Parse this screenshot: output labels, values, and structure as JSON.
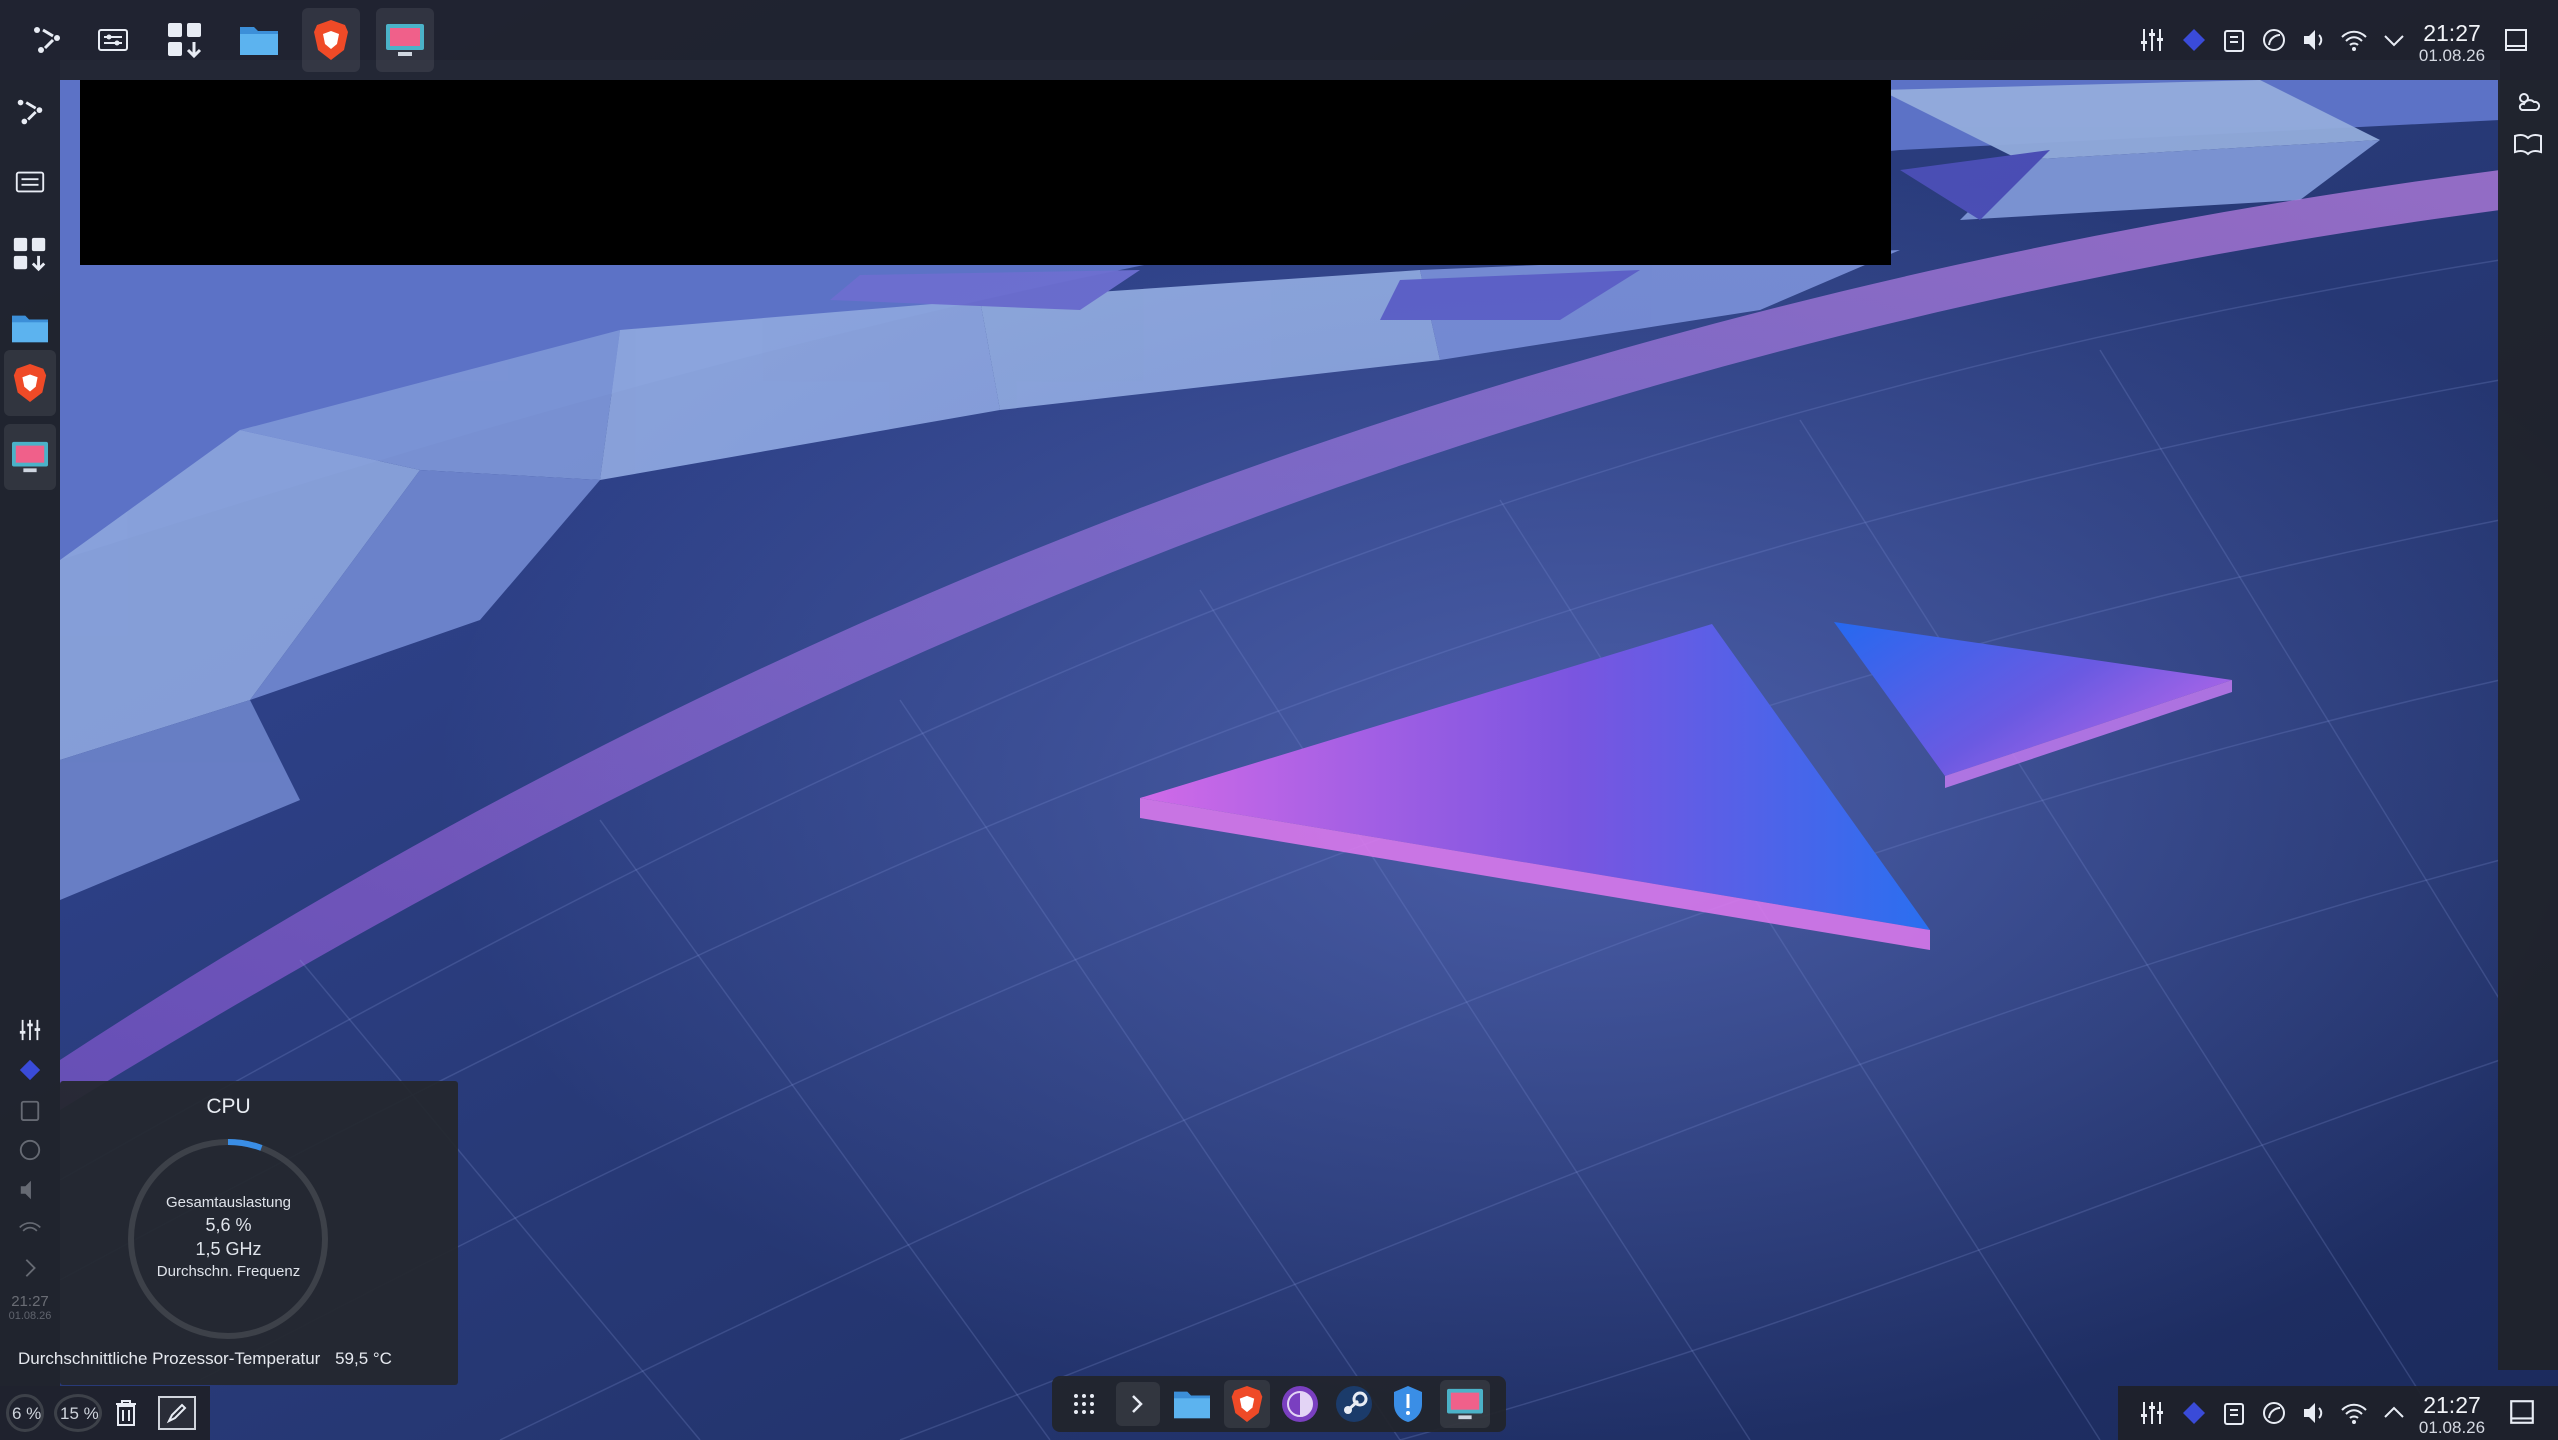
{
  "top_panel": {
    "launchers": [
      {
        "name": "kde-connect-icon"
      },
      {
        "name": "settings-icon"
      },
      {
        "name": "discover-icon"
      },
      {
        "name": "dolphin-icon"
      },
      {
        "name": "brave-icon"
      },
      {
        "name": "screen-tool-icon"
      }
    ],
    "tray": [
      "mixer-icon",
      "diamond-icon",
      "clipboard-icon",
      "vpn-icon",
      "volume-icon",
      "wifi-icon",
      "chevron-down-icon"
    ],
    "clock": {
      "time": "21:27",
      "date": "01.08.26"
    }
  },
  "bottom_panel": {
    "clock": {
      "time": "21:27",
      "date": "01.08.26"
    },
    "left_stats": {
      "cpu": "6 %",
      "mem": "15 %"
    }
  },
  "left_panel": {
    "clock": {
      "time": "21:27",
      "date": "01.08.26"
    }
  },
  "cpu_widget": {
    "title": "CPU",
    "load_label": "Gesamtauslastung",
    "load_value": "5,6 %",
    "freq_value": "1,5 GHz",
    "freq_label": "Durchschn. Frequenz",
    "temp_label": "Durchschnittliche Prozessor-Temperatur",
    "temp_value": "59,5 °C",
    "load_fraction": 0.056
  },
  "colors": {
    "panel": "#1e2128",
    "accent": "#3a8ee6",
    "brave": "#ef4a27",
    "wallpaper_deep": "#2a3a75",
    "wallpaper_light": "#7f9bdc",
    "triangle_pink": "#c263e6",
    "triangle_blue": "#2f69e8"
  }
}
